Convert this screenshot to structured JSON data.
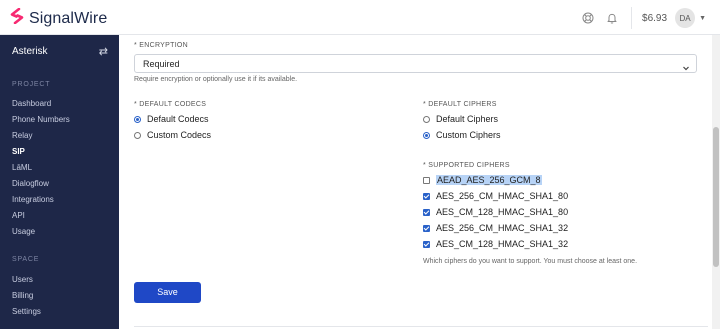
{
  "header": {
    "brand": "SignalWire",
    "balance": "$6.93",
    "avatar_initials": "DA",
    "icons": [
      "logo-icon",
      "support-icon",
      "bell-icon",
      "chevron-down-icon"
    ],
    "brand_color": "#f72a72"
  },
  "sidebar": {
    "project_name": "Asterisk",
    "project_section": "PROJECT",
    "project_items": [
      {
        "label": "Dashboard",
        "active": false
      },
      {
        "label": "Phone Numbers",
        "active": false
      },
      {
        "label": "Relay",
        "active": false
      },
      {
        "label": "SIP",
        "active": true
      },
      {
        "label": "LāML",
        "active": false
      },
      {
        "label": "Dialogflow",
        "active": false
      },
      {
        "label": "Integrations",
        "active": false
      },
      {
        "label": "API",
        "active": false
      },
      {
        "label": "Usage",
        "active": false
      }
    ],
    "space_section": "SPACE",
    "space_items": [
      {
        "label": "Users"
      },
      {
        "label": "Billing"
      },
      {
        "label": "Settings"
      }
    ],
    "background": "#1e2748"
  },
  "form": {
    "encryption": {
      "label": "* ENCRYPTION",
      "value": "Required",
      "help": "Require encryption or optionally use it if its available."
    },
    "codecs": {
      "label": "* DEFAULT CODECS",
      "options": [
        {
          "label": "Default Codecs",
          "selected": true
        },
        {
          "label": "Custom Codecs",
          "selected": false
        }
      ]
    },
    "ciphers": {
      "label": "* DEFAULT CIPHERS",
      "options": [
        {
          "label": "Default Ciphers",
          "selected": false
        },
        {
          "label": "Custom Ciphers",
          "selected": true
        }
      ]
    },
    "supported_ciphers": {
      "label": "* SUPPORTED CIPHERS",
      "items": [
        {
          "label": "AEAD_AES_256_GCM_8",
          "checked": false
        },
        {
          "label": "AES_256_CM_HMAC_SHA1_80",
          "checked": true
        },
        {
          "label": "AES_CM_128_HMAC_SHA1_80",
          "checked": true
        },
        {
          "label": "AES_256_CM_HMAC_SHA1_32",
          "checked": true
        },
        {
          "label": "AES_CM_128_HMAC_SHA1_32",
          "checked": true
        }
      ],
      "help": "Which ciphers do you want to support. You must choose at least one."
    },
    "save_label": "Save",
    "accent": "#1f48c6"
  }
}
